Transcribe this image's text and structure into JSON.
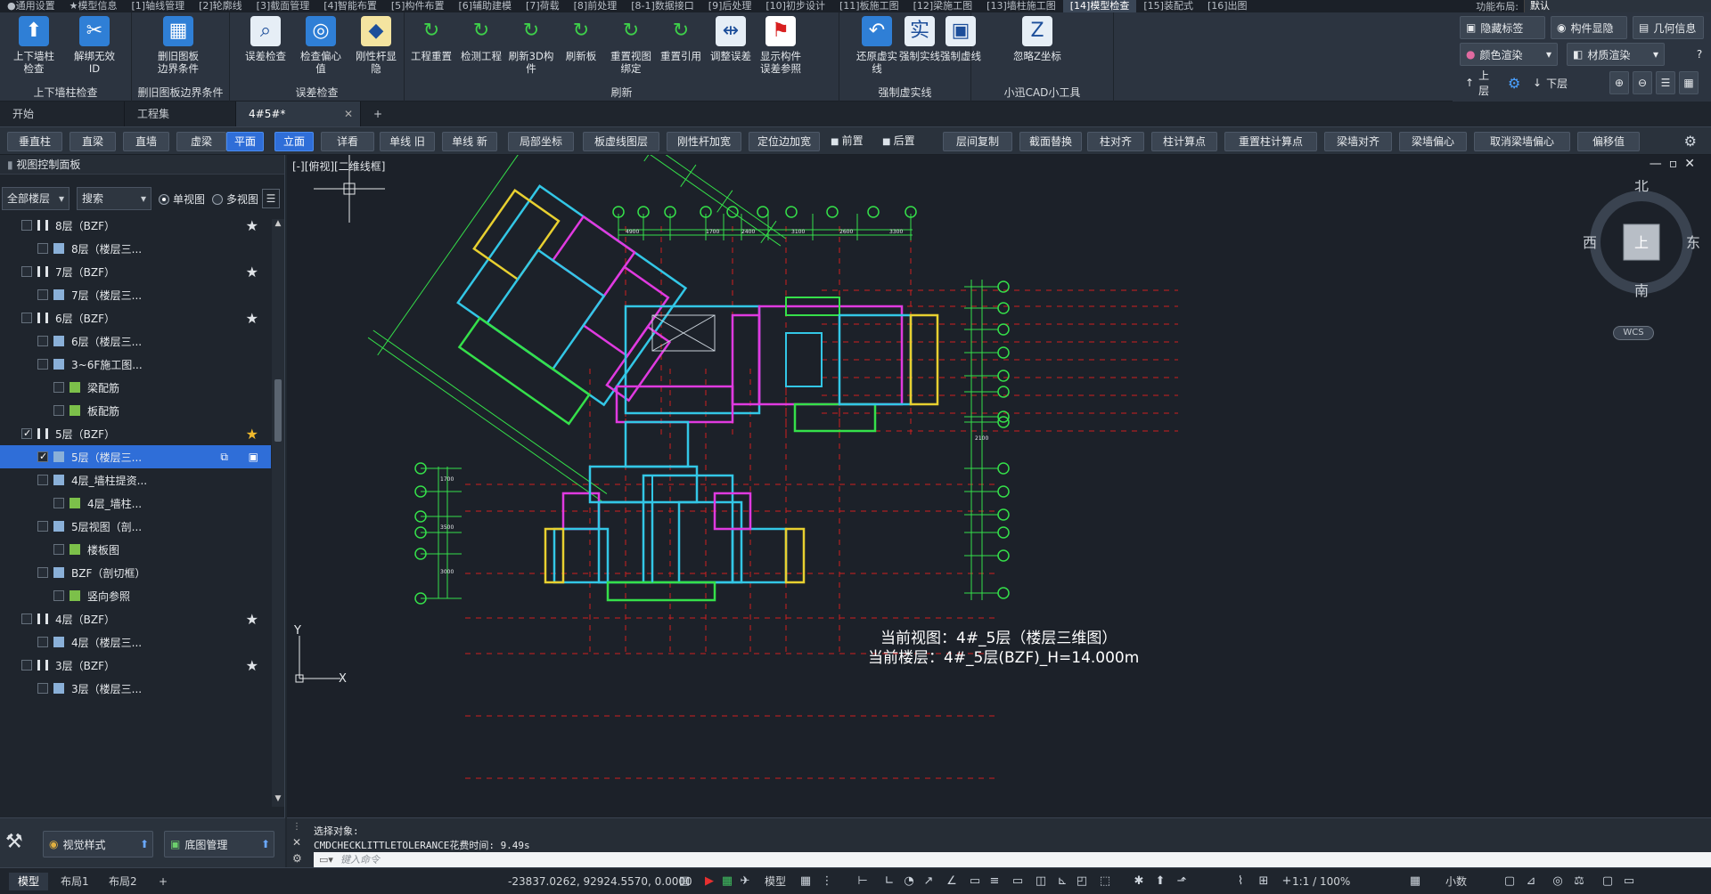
{
  "menu": {
    "tabs": [
      "●通用设置",
      "★模型信息",
      "[1]轴线管理",
      "[2]轮廓线",
      "[3]截面管理",
      "[4]智能布置",
      "[5]构件布置",
      "[6]辅助建模",
      "[7]荷载",
      "[8]前处理",
      "[8-1]数据接口",
      "[9]后处理",
      "[10]初步设计",
      "[11]板施工图",
      "[12]梁施工图",
      "[13]墙柱施工图",
      "[14]模型检查",
      "[15]装配式",
      "[16]出图"
    ],
    "active_index": 16,
    "func_layout_label": "功能布局:",
    "func_layout_value": "默认"
  },
  "ribbon": {
    "groups": [
      {
        "label": "上下墙柱检查",
        "tools": [
          "上下墙柱检查",
          "解绑无效ID"
        ]
      },
      {
        "label": "删旧图板边界条件",
        "tools": [
          "删旧图板\n边界条件"
        ]
      },
      {
        "label": "误差检查",
        "tools": [
          "误差检查",
          "检查偏心值",
          "刚性杆显隐"
        ]
      },
      {
        "label": "刷新",
        "tools": [
          "工程重置",
          "检测工程",
          "刷新3D构件",
          "刷新板",
          "重置视图绑定",
          "重置引用",
          "调整误差",
          "显示构件\n误差参照"
        ]
      },
      {
        "label": "强制虚实线",
        "tools": [
          "还原虚实线",
          "强制实线",
          "强制虚线"
        ]
      },
      {
        "label": "小迅CAD小工具",
        "tools": [
          "忽略Z坐标"
        ]
      }
    ],
    "right": {
      "hide_label": "隐藏标签",
      "member_toggle": "构件显隐",
      "geometry_info": "几何信息",
      "color_render": "颜色渲染",
      "material_render": "材质渲染",
      "up_floor": "上层",
      "down_floor": "下层"
    }
  },
  "doc_tabs": [
    "开始",
    "工程集",
    "4#5#*"
  ],
  "toolbar": {
    "buttons": [
      "垂直柱",
      "直梁",
      "直墙",
      "虚梁",
      "平面",
      "立面",
      "详看",
      "单线 旧",
      "单线 新",
      "局部坐标",
      "板虚线图层",
      "刚性杆加宽",
      "定位边加宽",
      "前置",
      "后置",
      "层间复制",
      "截面替换",
      "柱对齐",
      "柱计算点",
      "重置柱计算点",
      "梁墙对齐",
      "梁墙偏心",
      "取消梁墙偏心",
      "偏移值"
    ],
    "active": [
      "平面",
      "立面"
    ]
  },
  "left_panel": {
    "title": "视图控制面板",
    "floor_filter": "全部楼层",
    "search_placeholder": "搜索",
    "single_view": "单视图",
    "multi_view": "多视图",
    "tree": [
      {
        "label": "8层（BZF）",
        "level": 0,
        "star": true
      },
      {
        "label": "8层（楼层三...",
        "level": 1
      },
      {
        "label": "7层（BZF）",
        "level": 0,
        "star": true
      },
      {
        "label": "7层（楼层三...",
        "level": 1
      },
      {
        "label": "6层（BZF）",
        "level": 0,
        "star": true
      },
      {
        "label": "6层（楼层三...",
        "level": 1
      },
      {
        "label": "3~6F施工图...",
        "level": 1
      },
      {
        "label": "梁配筋",
        "level": 2
      },
      {
        "label": "板配筋",
        "level": 2
      },
      {
        "label": "5层（BZF）",
        "level": 0,
        "star": true,
        "gold": true,
        "checked": true
      },
      {
        "label": "5层（楼层三...",
        "level": 1,
        "selected": true,
        "checked": true
      },
      {
        "label": "4层_墙柱提资...",
        "level": 1
      },
      {
        "label": "4层_墙柱...",
        "level": 2
      },
      {
        "label": "5层视图（剖...",
        "level": 1
      },
      {
        "label": "楼板图",
        "level": 2
      },
      {
        "label": "BZF（剖切框）",
        "level": 1
      },
      {
        "label": "竖向参照",
        "level": 2
      },
      {
        "label": "4层（BZF）",
        "level": 0,
        "star": true
      },
      {
        "label": "4层（楼层三...",
        "level": 1
      },
      {
        "label": "3层（BZF）",
        "level": 0,
        "star": true
      },
      {
        "label": "3层（楼层三...",
        "level": 1
      }
    ],
    "bottom": {
      "visual_style": "视觉样式",
      "base_map": "底图管理"
    }
  },
  "canvas": {
    "view_label": "[-][俯视][二维线框]",
    "compass": {
      "north": "北",
      "south": "南",
      "east": "东",
      "west": "西",
      "center": "上",
      "wcs": "WCS"
    },
    "current_view": "当前视图：4#_5层（楼层三维图）",
    "current_floor": "当前楼层：4#_5层(BZF)_H=14.000m",
    "ucs_x": "X",
    "ucs_y": "Y"
  },
  "command": {
    "line1": "选择对象:",
    "line2": "CMDCHECKLITTLETOLERANCE花费时间: 9.49s",
    "placeholder": "键入命令"
  },
  "status": {
    "layout_tabs": [
      "模型",
      "布局1",
      "布局2"
    ],
    "coords": "-23837.0262, 92924.5570, 0.0000",
    "model": "模型",
    "scale": "1:1 / 100%",
    "decimal": "小数"
  },
  "colors": {
    "accent": "#2f6ed8",
    "grid_green": "#35e04a",
    "wall_cyan": "#33c7e6",
    "wall_magenta": "#e03ae0",
    "wall_yellow": "#e8d030",
    "axis_red": "#d02020"
  }
}
